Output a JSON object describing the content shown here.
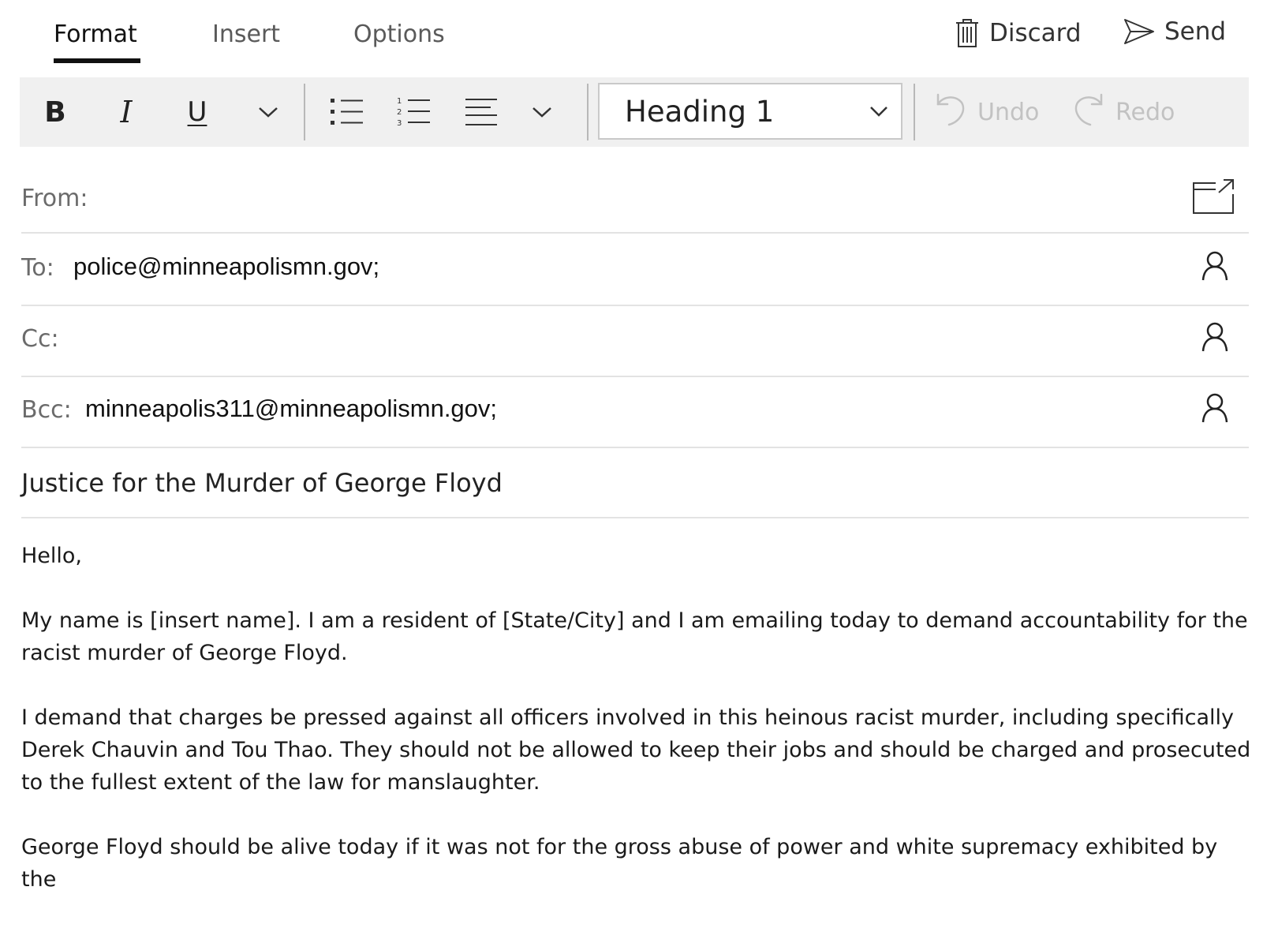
{
  "tabs": [
    {
      "label": "Format",
      "active": true
    },
    {
      "label": "Insert",
      "active": false
    },
    {
      "label": "Options",
      "active": false
    }
  ],
  "actions": {
    "discard": {
      "label": "Discard",
      "icon": "trash-icon"
    },
    "send": {
      "label": "Send",
      "icon": "send-icon"
    }
  },
  "ribbon": {
    "bold_glyph": "B",
    "italic_glyph": "I",
    "underline_glyph": "U",
    "style_value": "Heading 1",
    "undo_label": "Undo",
    "redo_label": "Redo"
  },
  "fields": {
    "from": {
      "label": "From:",
      "value": ""
    },
    "to": {
      "label": "To:",
      "value": "police@minneapolismn.gov;"
    },
    "cc": {
      "label": "Cc:",
      "value": ""
    },
    "bcc": {
      "label": "Bcc:",
      "value": "minneapolis311@minneapolismn.gov;"
    }
  },
  "subject": "Justice for the Murder of George Floyd",
  "body": {
    "greeting": "Hello,",
    "p1": "My name is [insert name]. I am a resident of [State/City] and I am emailing today to demand accountability for the racist murder of George Floyd.",
    "p2": "I demand that charges be pressed against all officers involved in this heinous racist murder, including specifically Derek Chauvin and Tou Thao. They should not be allowed to keep their jobs and should be charged and prosecuted to the fullest extent of the law for manslaughter.",
    "p3": "George Floyd should be alive today if it was not for the gross abuse of power and white supremacy exhibited by the"
  },
  "colors": {
    "ribbon_bg": "#f0f0f0",
    "disabled_text": "#c2c2c2",
    "divider": "#e3e3e3"
  }
}
